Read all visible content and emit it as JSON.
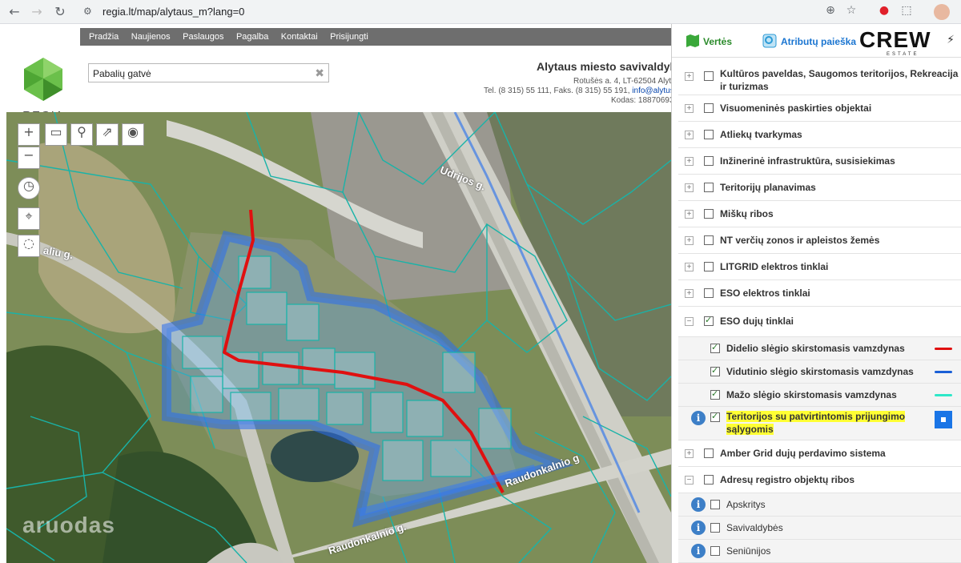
{
  "browser": {
    "url": "regia.lt/map/alytaus_m?lang=0"
  },
  "site": {
    "logo_text": "REGIA",
    "nav": [
      "Pradžia",
      "Naujienos",
      "Paslaugos",
      "Pagalba",
      "Kontaktai",
      "Prisijungti"
    ],
    "search_value": "Pabalių gatvė",
    "muni_title": "Alytaus miesto savivaldyb",
    "muni_address": "Rotušės a. 4, LT-62504 Alytu",
    "muni_phone": "Tel. (8 315) 55 111, Faks. (8 315) 55 191,",
    "muni_email": "info@alytus",
    "muni_code": "Kodas: 18870693"
  },
  "map": {
    "watermark": "aruodas",
    "road_labels": {
      "udrijos": "Udrijos g.",
      "raudonkalnio_1": "Raudonkalnio g",
      "raudonkalnio_2": "Raudonkalnio g.",
      "pabaliu": "aliu g."
    }
  },
  "panel": {
    "tab_values": "Vertės",
    "tab_search": "Atributų paieška",
    "brand": "CREW",
    "brand_sub": "ESTATE",
    "layers": [
      {
        "label": "Kultūros paveldas, Saugomos teritorijos, Rekreacija ir turizmas",
        "checked": false,
        "expanded": false
      },
      {
        "label": "Visuomeninės paskirties objektai",
        "checked": false,
        "expanded": false
      },
      {
        "label": "Atliekų tvarkymas",
        "checked": false,
        "expanded": false
      },
      {
        "label": "Inžinerinė infrastruktūra, susisiekimas",
        "checked": false,
        "expanded": false
      },
      {
        "label": "Teritorijų planavimas",
        "checked": false,
        "expanded": false
      },
      {
        "label": "Miškų ribos",
        "checked": false,
        "expanded": false
      },
      {
        "label": "NT verčių zonos ir apleistos žemės",
        "checked": false,
        "expanded": false
      },
      {
        "label": "LITGRID elektros tinklai",
        "checked": false,
        "expanded": false
      },
      {
        "label": "ESO elektros tinklai",
        "checked": false,
        "expanded": false
      },
      {
        "label": "ESO dujų tinklai",
        "checked": true,
        "expanded": true
      },
      {
        "label": "Amber Grid dujų perdavimo sistema",
        "checked": false,
        "expanded": false
      },
      {
        "label": "Adresų registro objektų ribos",
        "checked": false,
        "expanded": true
      }
    ],
    "gas_sublayers": [
      {
        "label": "Didelio slėgio skirstomasis vamzdynas",
        "checked": true,
        "color": "#e01010"
      },
      {
        "label": "Vidutinio slėgio skirstomasis vamzdynas",
        "checked": true,
        "color": "#1a5fd6"
      },
      {
        "label": "Mažo slėgio skirstomasis vamzdynas",
        "checked": true,
        "color": "#2ee8c8"
      },
      {
        "label": "Teritorijos su patvirtintomis prijungimo sąlygomis",
        "checked": true,
        "color": "#1a75e6"
      }
    ],
    "address_sublayers": [
      {
        "label": "Apskritys",
        "checked": false
      },
      {
        "label": "Savivaldybės",
        "checked": false
      },
      {
        "label": "Seniūnijos",
        "checked": false
      }
    ]
  },
  "colors": {
    "map_aerial": "#7a8a5a",
    "parcel_line": "#19b3a8",
    "gas_high": "#e01010",
    "zone_blue": "#2a6ef0",
    "nav_bar": "#6e6e6e",
    "link_blue": "#1a75d1"
  }
}
